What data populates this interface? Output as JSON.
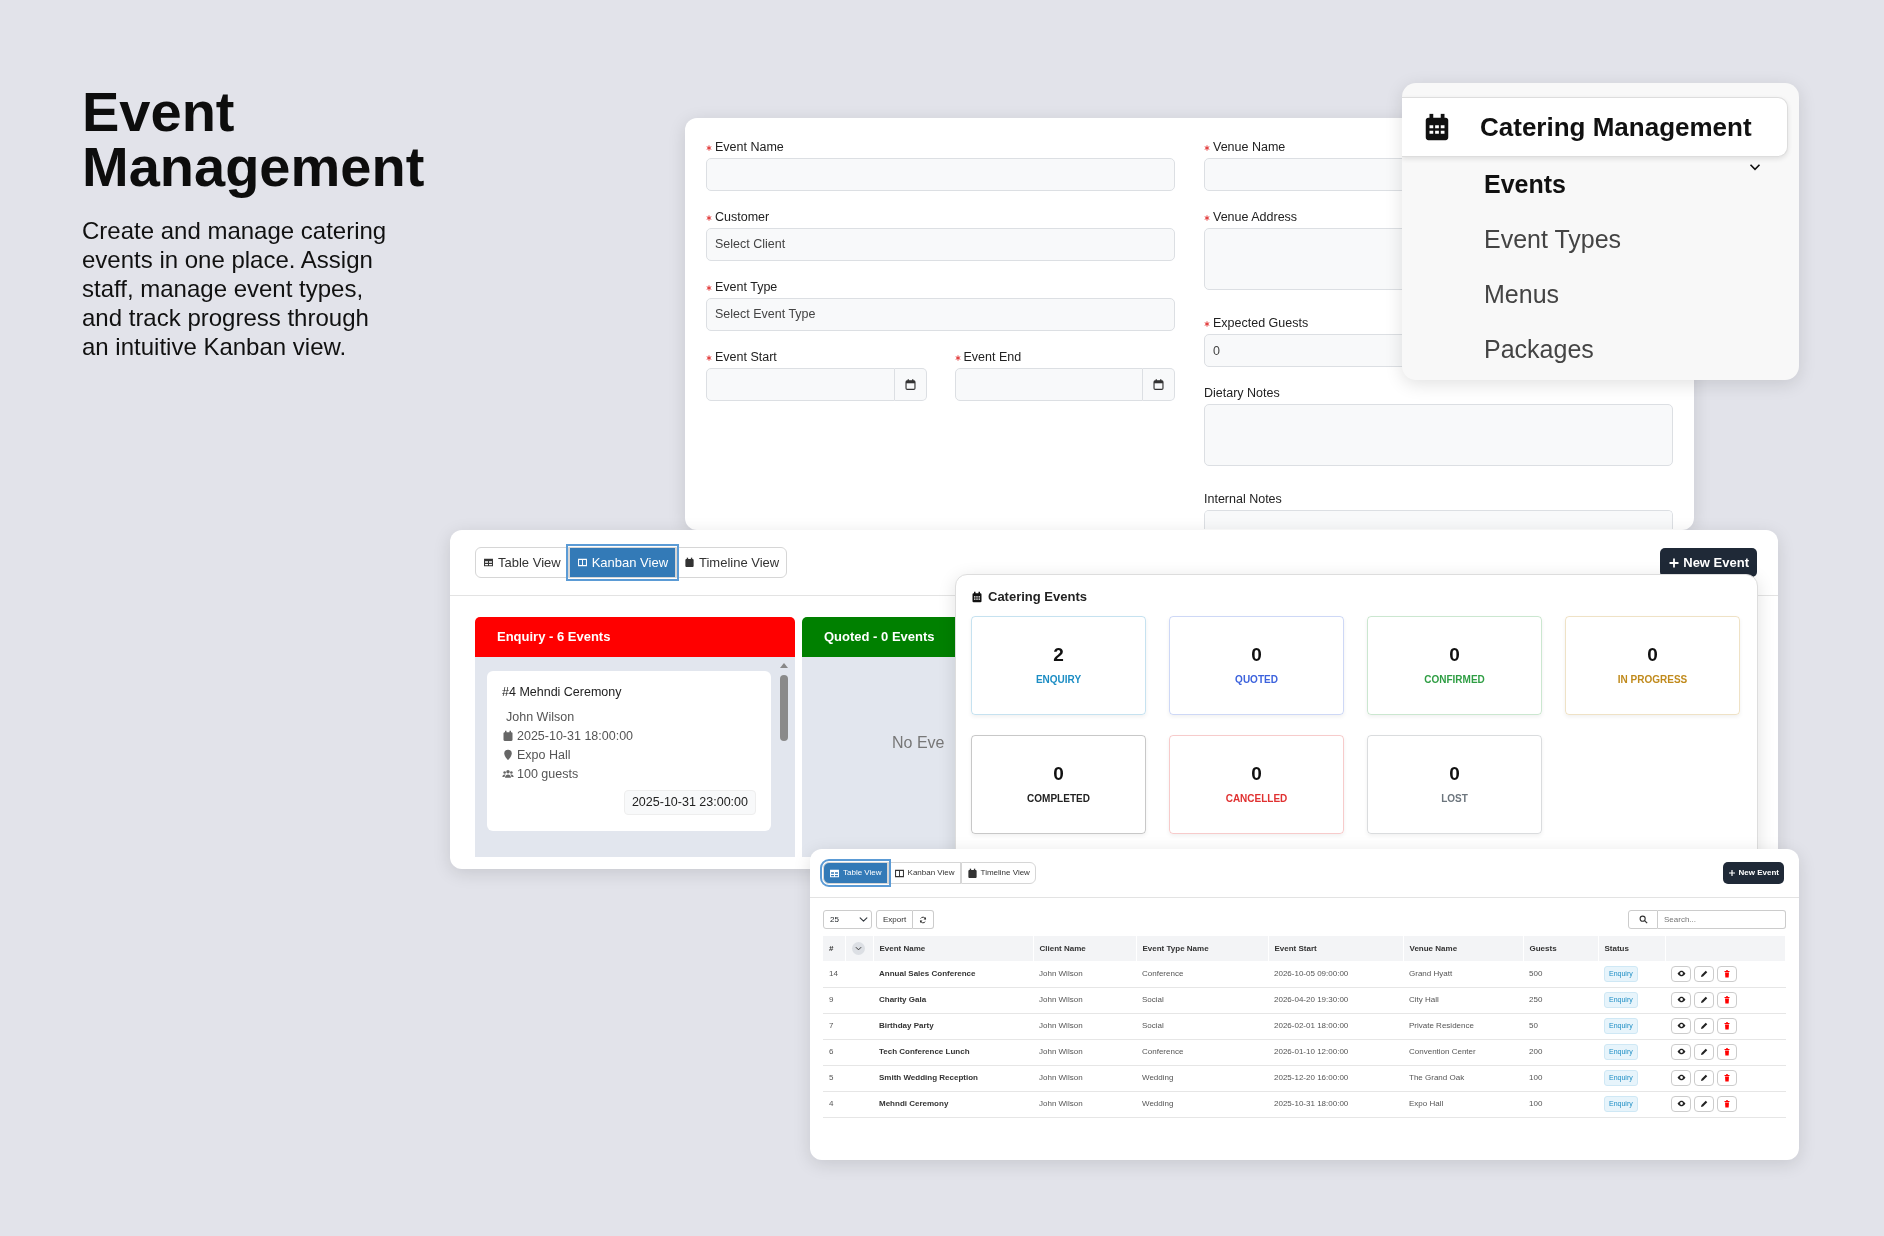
{
  "hero": {
    "title": "Event Management",
    "description": "Create and manage catering events in one place. Assign staff, manage event types, and track progress through an intuitive Kanban view."
  },
  "event_form": {
    "left_fields": [
      {
        "label": "Event Name",
        "required": true,
        "kind": "text"
      },
      {
        "label": "Customer",
        "required": true,
        "kind": "select",
        "value": "Select Client"
      },
      {
        "label": "Event Type",
        "required": true,
        "kind": "select",
        "value": "Select Event Type"
      },
      {
        "label": "Event Start",
        "required": true,
        "kind": "date"
      },
      {
        "label": "Event End",
        "required": true,
        "kind": "date"
      }
    ],
    "right_fields": [
      {
        "label": "Venue Name",
        "required": true,
        "kind": "text"
      },
      {
        "label": "Venue Address",
        "required": true,
        "kind": "textarea"
      },
      {
        "label": "Expected Guests",
        "required": true,
        "kind": "text",
        "value": "0"
      },
      {
        "label": "Dietary Notes",
        "required": false,
        "kind": "textarea"
      },
      {
        "label": "Internal Notes",
        "required": false,
        "kind": "textarea"
      }
    ]
  },
  "sidebar_menu": {
    "title": "Catering Management",
    "expanded": true,
    "items": [
      {
        "label": "Events",
        "selected": true
      },
      {
        "label": "Event Types",
        "selected": false
      },
      {
        "label": "Menus",
        "selected": false
      },
      {
        "label": "Packages",
        "selected": false
      }
    ]
  },
  "kanban_view": {
    "view_tabs": [
      {
        "label": "Table View",
        "kind": "table",
        "selected": false
      },
      {
        "label": "Kanban View",
        "kind": "kanban",
        "selected": true
      },
      {
        "label": "Timeline View",
        "kind": "timeline",
        "selected": false
      }
    ],
    "new_event_button": "New Event",
    "columns": [
      {
        "title": "Enquiry - 6 Events",
        "color": "#ff0000",
        "cards": [
          {
            "title": "#4 Mehndi Ceremony",
            "client": "John Wilson",
            "start": "2025-10-31 18:00:00",
            "venue": "Expo Hall",
            "guests": "100 guests",
            "end": "2025-10-31 23:00:00"
          }
        ]
      },
      {
        "title": "Quoted - 0 Events",
        "color": "#008000",
        "empty_text": "No Eve"
      }
    ]
  },
  "catering_events": {
    "title": "Catering Events",
    "stats": [
      {
        "count": "2",
        "label": "ENQUIRY",
        "color": "#1c8dc4"
      },
      {
        "count": "0",
        "label": "QUOTED",
        "color": "#3d63dd"
      },
      {
        "count": "0",
        "label": "CONFIRMED",
        "color": "#2f9e44"
      },
      {
        "count": "0",
        "label": "IN PROGRESS",
        "color": "#c08a1c"
      },
      {
        "count": "0",
        "label": "COMPLETED",
        "color": "#222222"
      },
      {
        "count": "0",
        "label": "CANCELLED",
        "color": "#e03131"
      },
      {
        "count": "0",
        "label": "LOST",
        "color": "#6c757d"
      }
    ]
  },
  "table_view": {
    "view_tabs": [
      {
        "label": "Table View",
        "kind": "table",
        "selected": true
      },
      {
        "label": "Kanban View",
        "kind": "kanban",
        "selected": false
      },
      {
        "label": "Timeline View",
        "kind": "timeline",
        "selected": false
      }
    ],
    "new_event_button": "New Event",
    "page_size": "25",
    "export_button": "Export",
    "search": {
      "placeholder": "Search..."
    },
    "columns": [
      "#",
      "Event Name",
      "Client Name",
      "Event Type Name",
      "Event Start",
      "Venue Name",
      "Guests",
      "Status"
    ],
    "rows": [
      {
        "cells": [
          "14",
          "Annual Sales Conference",
          "John Wilson",
          "Conference",
          "2026-10-05 09:00:00",
          "Grand Hyatt",
          "500"
        ],
        "status": "Enquiry"
      },
      {
        "cells": [
          "9",
          "Charity Gala",
          "John Wilson",
          "Social",
          "2026-04-20 19:30:00",
          "City Hall",
          "250"
        ],
        "status": "Enquiry"
      },
      {
        "cells": [
          "7",
          "Birthday Party",
          "John Wilson",
          "Social",
          "2026-02-01 18:00:00",
          "Private Residence",
          "50"
        ],
        "status": "Enquiry"
      },
      {
        "cells": [
          "6",
          "Tech Conference Lunch",
          "John Wilson",
          "Conference",
          "2026-01-10 12:00:00",
          "Convention Center",
          "200"
        ],
        "status": "Enquiry"
      },
      {
        "cells": [
          "5",
          "Smith Wedding Reception",
          "John Wilson",
          "Wedding",
          "2025-12-20 16:00:00",
          "The Grand Oak",
          "100"
        ],
        "status": "Enquiry"
      },
      {
        "cells": [
          "4",
          "Mehndi Ceremony",
          "John Wilson",
          "Wedding",
          "2025-10-31 18:00:00",
          "Expo Hall",
          "100"
        ],
        "status": "Enquiry"
      }
    ]
  }
}
